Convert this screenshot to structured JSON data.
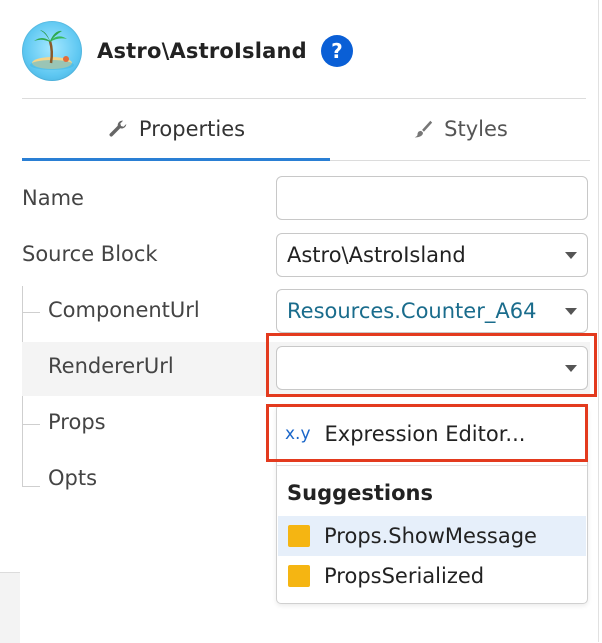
{
  "header": {
    "title": "Astro\\AstroIsland",
    "help_label": "?",
    "logo_icon": "island-logo-icon"
  },
  "tabs": [
    {
      "label": "Properties",
      "icon": "wrench-icon",
      "active": true
    },
    {
      "label": "Styles",
      "icon": "brush-icon",
      "active": false
    }
  ],
  "form": {
    "name": {
      "label": "Name",
      "value": ""
    },
    "source_block": {
      "label": "Source Block",
      "value": "Astro\\AstroIsland"
    },
    "component_url": {
      "label": "ComponentUrl",
      "value": "Resources.Counter_A64"
    },
    "renderer_url": {
      "label": "RendererUrl",
      "value": ""
    },
    "props": {
      "label": "Props"
    },
    "opts": {
      "label": "Opts"
    }
  },
  "dropdown": {
    "expression_prefix": "x.y",
    "expression_label": "Expression Editor...",
    "suggestions_title": "Suggestions",
    "suggestions": [
      {
        "label": "Props.ShowMessage",
        "selected": true
      },
      {
        "label": "PropsSerialized",
        "selected": false
      }
    ]
  },
  "colors": {
    "accent": "#2a7fd4",
    "help_badge": "#0a5fd6",
    "link_value": "#1a6c8c",
    "highlight_outline": "#e33a1e",
    "suggestion_square": "#f5b512"
  }
}
